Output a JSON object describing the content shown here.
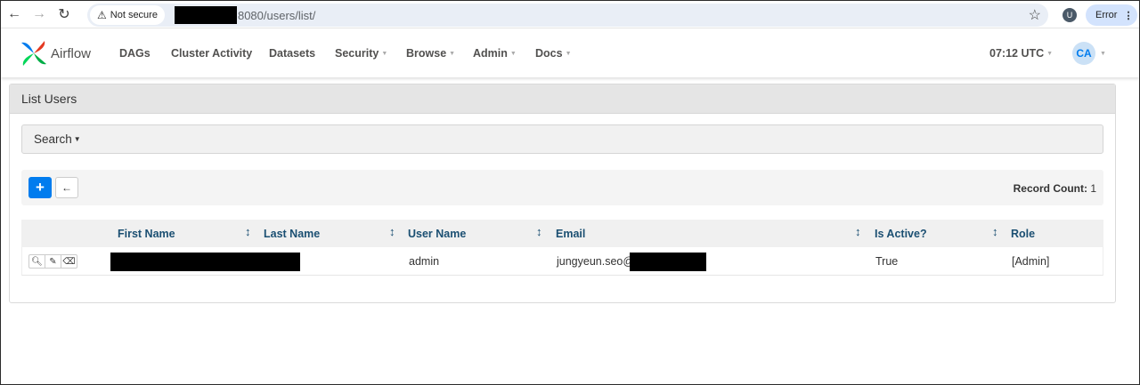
{
  "browser": {
    "security_label": "Not secure",
    "url_suffix": "8080/users/list/",
    "profile_initial": "U",
    "error_label": "Error"
  },
  "navbar": {
    "brand": "Airflow",
    "items": [
      {
        "label": "DAGs"
      },
      {
        "label": "Cluster Activity"
      },
      {
        "label": "Datasets"
      },
      {
        "label": "Security"
      },
      {
        "label": "Browse"
      },
      {
        "label": "Admin"
      },
      {
        "label": "Docs"
      }
    ],
    "clock": "07:12 UTC",
    "avatar": "CA"
  },
  "panel": {
    "title": "List Users",
    "search_label": "Search",
    "record_count_label": "Record Count:",
    "record_count": "1"
  },
  "table": {
    "columns": [
      "First Name",
      "Last Name",
      "User Name",
      "Email",
      "Is Active?",
      "Role"
    ],
    "rows": [
      {
        "first_name": "",
        "last_name": "",
        "user_name": "admin",
        "email": "jungyeun.seo@",
        "is_active": "True",
        "role": "[Admin]"
      }
    ]
  },
  "colors": {
    "primary": "#017cee",
    "header_text": "#1b4f72",
    "brand_text": "#51504f"
  }
}
